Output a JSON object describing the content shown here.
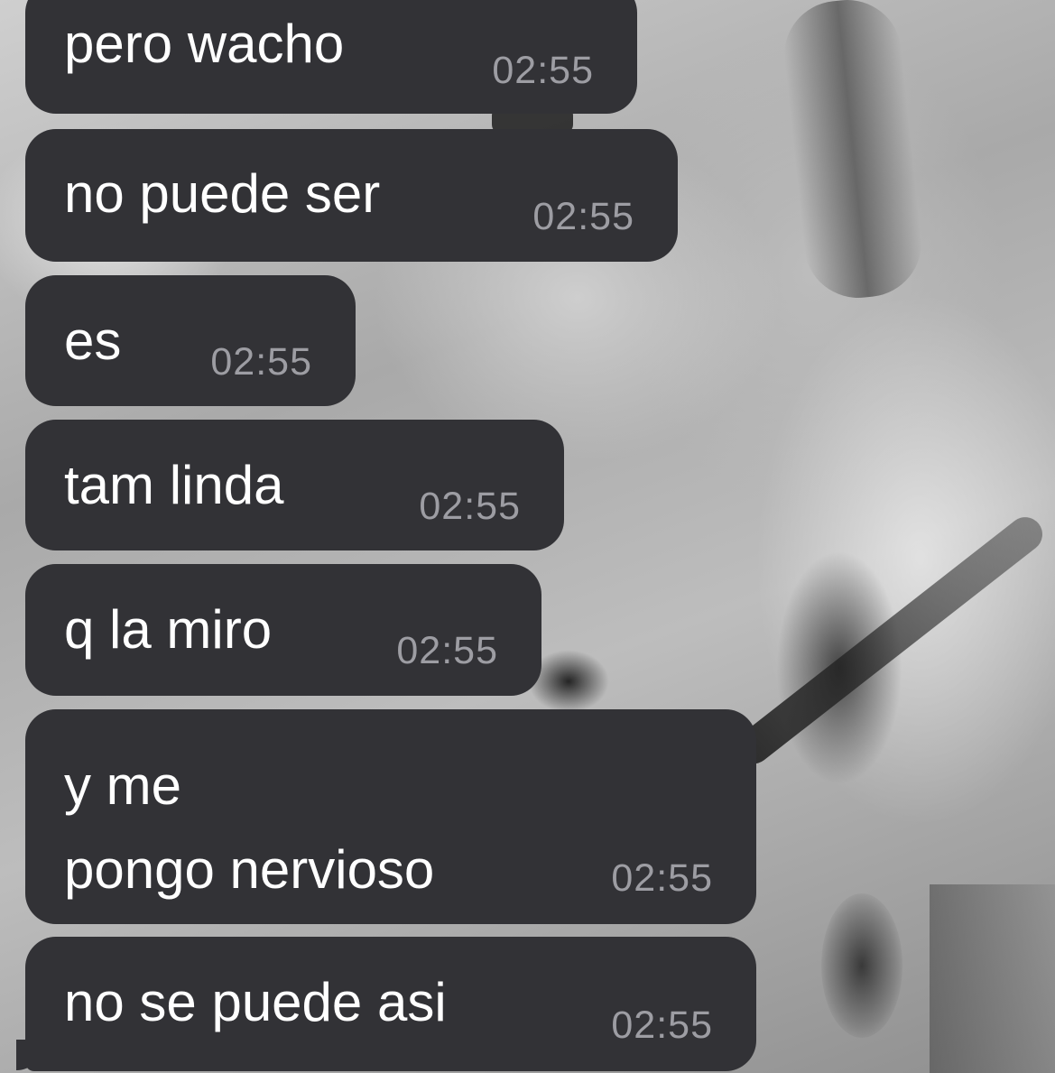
{
  "chat": {
    "messages": [
      {
        "text": "pero wacho",
        "time": "02:55"
      },
      {
        "text": "no puede ser",
        "time": "02:55"
      },
      {
        "text": "es",
        "time": "02:55"
      },
      {
        "text": "tam linda",
        "time": "02:55"
      },
      {
        "text": "q la miro",
        "time": "02:55"
      },
      {
        "text": "y me\npongo nervioso",
        "time": "02:55"
      },
      {
        "text": "no se puede asi",
        "time": "02:55"
      }
    ],
    "bubble_color": "#323236",
    "text_color": "#ffffff",
    "time_color": "#9d9da3"
  }
}
